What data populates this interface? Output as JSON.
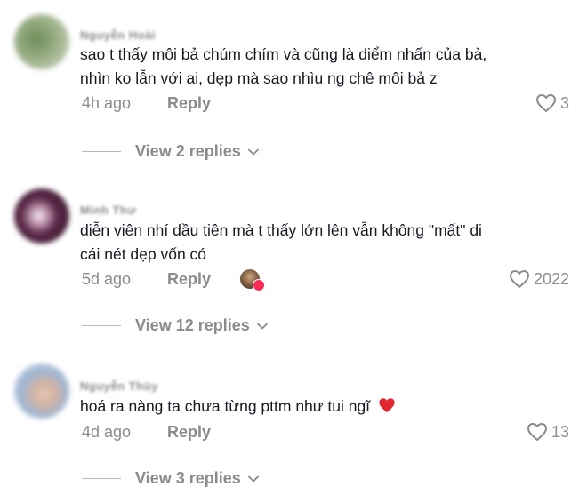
{
  "comments": [
    {
      "username": "Nguyễn Hoài",
      "text_line1": "sao t thấy môi bả chúm chím và cũng là diểm nhấn của bả,",
      "text_line2": "nhìn ko lẫn với ai, dẹp mà sao nhìu ng chê môi bả z",
      "time": "4h ago",
      "reply_label": "Reply",
      "likes": "3",
      "view_replies": "View 2 replies"
    },
    {
      "username": "Minh Thư",
      "text_line1": "diễn viên nhí dầu tiên mà t thấy lớn lên vẫn không \"mất\" di",
      "text_line2": "cái nét dẹp vốn có",
      "time": "5d ago",
      "reply_label": "Reply",
      "likes": "2022",
      "view_replies": "View 12 replies"
    },
    {
      "username": "Nguyễn Thùy",
      "text_line1": "hoá ra nàng ta chưa từng pttm như tui ngĩ",
      "time": "4d ago",
      "reply_label": "Reply",
      "likes": "13",
      "view_replies": "View 3 replies"
    }
  ],
  "colors": {
    "text": "#161823",
    "muted": "#8a8b91",
    "heart_emoji": "#e0282e",
    "badge": "#fe2c55"
  },
  "icons": [
    "heart-outline-icon",
    "chevron-down-icon",
    "red-heart-emoji-icon",
    "creator-liked-avatar"
  ]
}
